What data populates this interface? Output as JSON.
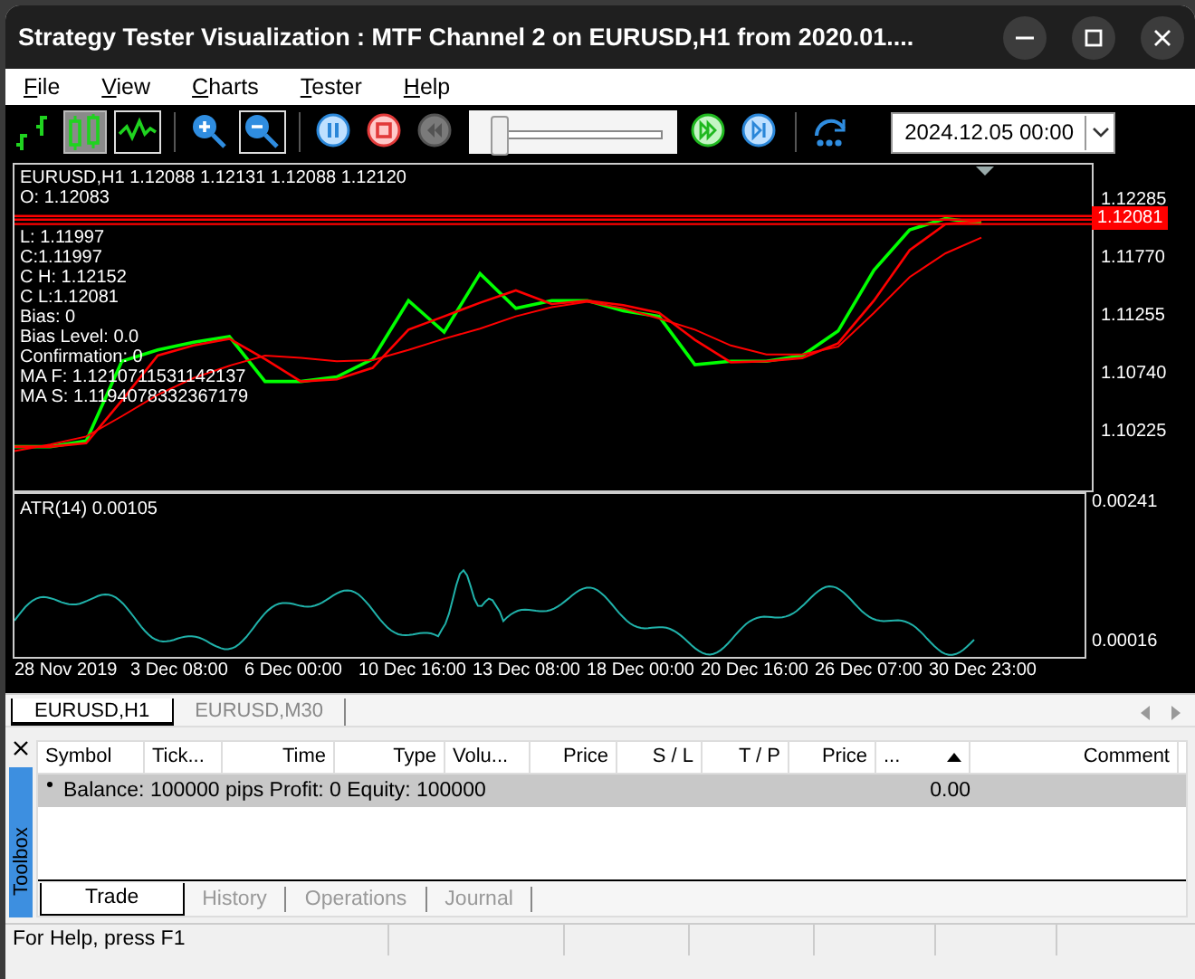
{
  "window": {
    "title": "Strategy Tester Visualization : MTF Channel 2 on EURUSD,H1 from 2020.01...."
  },
  "menu": [
    {
      "label": "File"
    },
    {
      "label": "View"
    },
    {
      "label": "Charts"
    },
    {
      "label": "Tester"
    },
    {
      "label": "Help"
    }
  ],
  "toolbar": {
    "buttons": [
      {
        "kind": "bars",
        "selected": false,
        "disabled": false
      },
      {
        "kind": "candles",
        "selected": true,
        "disabled": false
      },
      {
        "kind": "line",
        "selected": false,
        "disabled": false
      },
      {
        "kind": "separator"
      },
      {
        "kind": "zoom-in",
        "selected": false,
        "disabled": false
      },
      {
        "kind": "zoom-out",
        "selected": false,
        "disabled": false
      },
      {
        "kind": "separator"
      },
      {
        "kind": "pause",
        "selected": false,
        "disabled": false
      },
      {
        "kind": "stop",
        "selected": false,
        "disabled": false
      },
      {
        "kind": "rewind",
        "selected": false,
        "disabled": true
      },
      {
        "kind": "slider",
        "level": 0.03
      },
      {
        "kind": "fast-forward",
        "selected": false,
        "disabled": false
      },
      {
        "kind": "step",
        "selected": false,
        "disabled": false
      },
      {
        "kind": "separator"
      },
      {
        "kind": "speed",
        "selected": false,
        "disabled": false
      }
    ],
    "date": "2024.12.05 00:00"
  },
  "chart": {
    "header": "EURUSD,H1  1.12088 1.12131 1.12088 1.12120",
    "info_top": [
      "O: 1.12083"
    ],
    "info_lines": [
      "L: 1.11997",
      "C:1.11997",
      "C H: 1.12152",
      "C L:1.12081",
      "Bias: 0",
      "Bias Level: 0.0",
      "Confirmation: 0",
      "MA F: 1.1210711531142137",
      "MA S: 1.1194078332367179"
    ],
    "chart_data": {
      "type": "line",
      "ylim": [
        1.0971,
        1.1261
      ],
      "ref_lines": [
        {
          "axis": "y",
          "value": 1.12152,
          "color": "#ff0000"
        },
        {
          "axis": "y",
          "value": 1.1212,
          "color": "#ff0000"
        },
        {
          "axis": "y",
          "value": 1.12081,
          "color": "#ff0000"
        }
      ],
      "yticks": [
        {
          "value": 1.12285,
          "label": "1.12285"
        },
        {
          "value": 1.1177,
          "label": "1.11770"
        },
        {
          "value": 1.11255,
          "label": "1.11255"
        },
        {
          "value": 1.1074,
          "label": "1.10740"
        },
        {
          "value": 1.10225,
          "label": "1.10225"
        }
      ],
      "series": [
        {
          "color": "#00ff00",
          "values": [
            1.101,
            1.101,
            1.1015,
            1.1086,
            1.1096,
            1.1103,
            1.1108,
            1.1068,
            1.1068,
            1.1072,
            1.1088,
            1.114,
            1.1112,
            1.1164,
            1.1133,
            1.114,
            1.114,
            1.1131,
            1.1126,
            1.1083,
            1.1086,
            1.1086,
            1.1091,
            1.1113,
            1.1167,
            1.1203,
            1.1213,
            1.1209
          ]
        },
        {
          "color": "#ff0000",
          "values": [
            1.101,
            1.101,
            1.1013,
            1.1051,
            1.1091,
            1.11,
            1.1106,
            1.1088,
            1.1068,
            1.107,
            1.108,
            1.1114,
            1.1126,
            1.1138,
            1.1149,
            1.1137,
            1.114,
            1.1136,
            1.1129,
            1.1105,
            1.1085,
            1.1086,
            1.1089,
            1.1102,
            1.114,
            1.1185,
            1.1208,
            1.1211
          ]
        },
        {
          "color": "#ff0000",
          "values": [
            1.1006,
            1.1012,
            1.1019,
            1.1037,
            1.1056,
            1.1071,
            1.1082,
            1.1091,
            1.1089,
            1.1086,
            1.1087,
            1.1096,
            1.1106,
            1.1115,
            1.1126,
            1.1134,
            1.1139,
            1.1133,
            1.1124,
            1.1114,
            1.11,
            1.1092,
            1.1092,
            1.1099,
            1.1129,
            1.1161,
            1.1182,
            1.1196
          ]
        }
      ]
    },
    "current_price": "1.12081",
    "indicator": {
      "label": "ATR(14) 0.00105",
      "ticks": [
        "0.00241",
        "0.00016"
      ]
    },
    "time_ticks": [
      "28 Nov 2019",
      "3 Dec 08:00",
      "6 Dec 00:00",
      "10 Dec 16:00",
      "13 Dec 08:00",
      "18 Dec 00:00",
      "20 Dec 16:00",
      "26 Dec 07:00",
      "30 Dec 23:00"
    ]
  },
  "chart_tabs": [
    {
      "label": "EURUSD,H1",
      "selected": true
    },
    {
      "label": "EURUSD,M30",
      "selected": false
    }
  ],
  "toolbox": {
    "title": "Toolbox",
    "columns": [
      {
        "label": "Symbol",
        "sorted": false
      },
      {
        "label": "Tick...",
        "sorted": false
      },
      {
        "label": "Time",
        "sorted": false
      },
      {
        "label": "Type",
        "sorted": false
      },
      {
        "label": "Volu...",
        "sorted": false
      },
      {
        "label": "Price",
        "sorted": false
      },
      {
        "label": "S / L",
        "sorted": false
      },
      {
        "label": "T / P",
        "sorted": false
      },
      {
        "label": "Price",
        "sorted": false
      },
      {
        "label": "...",
        "sorted": true
      },
      {
        "label": "Comment",
        "sorted": false
      }
    ],
    "rows": [
      {
        "text": "Balance: 100000 pips  Profit: 0  Equity: 100000",
        "value": "0.00",
        "selected": true
      }
    ],
    "tabs": [
      {
        "label": "Trade",
        "selected": true
      },
      {
        "label": "History",
        "selected": false
      },
      {
        "label": "Operations",
        "selected": false
      },
      {
        "label": "Journal",
        "selected": false
      }
    ]
  },
  "status_bar": {
    "text": "For Help, press F1"
  }
}
